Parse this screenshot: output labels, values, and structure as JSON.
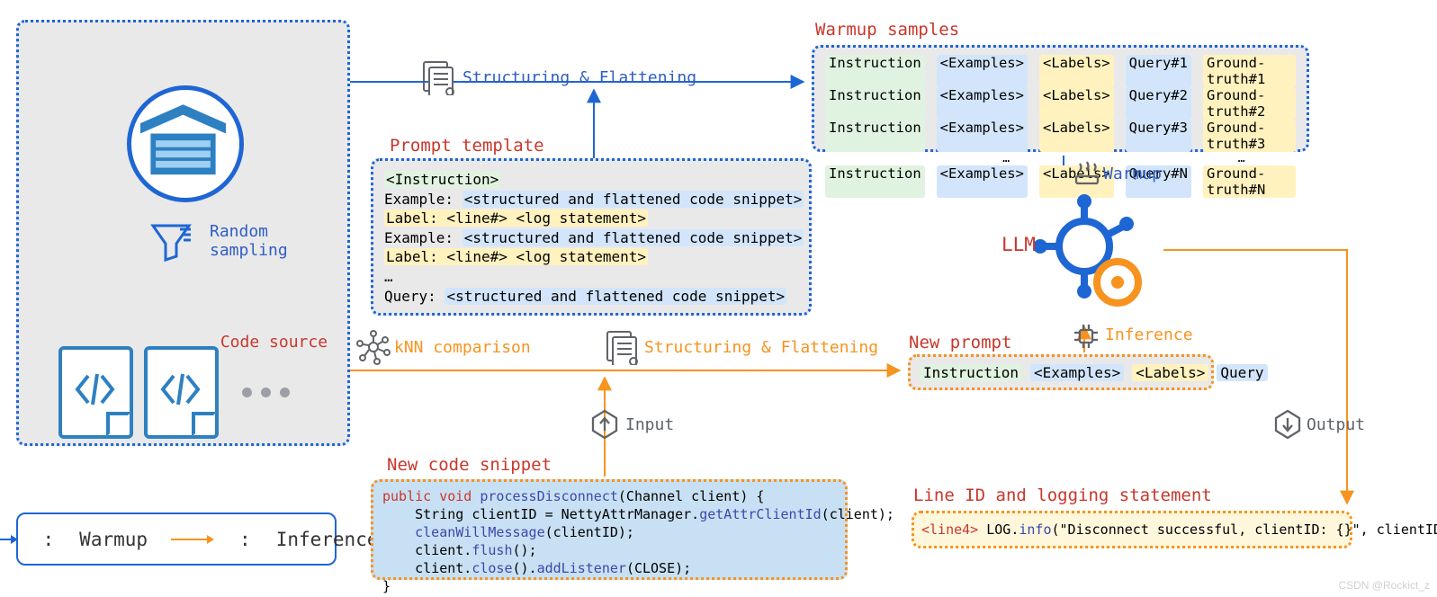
{
  "panels": {
    "code_source_label": "Code source",
    "random_sampling": "Random\nsampling"
  },
  "legend": {
    "warmup": "Warmup",
    "inference": "Inference"
  },
  "arrows": {
    "structuring_flattening": "Structuring & Flattening",
    "knn_comparison": "kNN comparison",
    "input": "Input",
    "warmup": "Warmup",
    "inference": "Inference",
    "output": "Output"
  },
  "prompt_template": {
    "title": "Prompt template",
    "instruction": "<Instruction>",
    "example_prefix": "Example:",
    "example_body": "<structured and flattened code snippet>",
    "label_line": "Label: <line#> <log statement>",
    "ellipsis": "…",
    "query_prefix": "Query:",
    "query_body": "<structured and flattened code snippet>"
  },
  "warmup_samples": {
    "title": "Warmup samples",
    "rows": [
      {
        "instr": "Instruction",
        "ex": "<Examples>",
        "lab": "<Labels>",
        "q": "Query#1",
        "gt": "Ground-truth#1"
      },
      {
        "instr": "Instruction",
        "ex": "<Examples>",
        "lab": "<Labels>",
        "q": "Query#2",
        "gt": "Ground-truth#2"
      },
      {
        "instr": "Instruction",
        "ex": "<Examples>",
        "lab": "<Labels>",
        "q": "Query#3",
        "gt": "Ground-truth#3"
      },
      {
        "instr": "Instruction",
        "ex": "<Examples>",
        "lab": "<Labels>",
        "q": "Query#N",
        "gt": "Ground-truth#N"
      }
    ],
    "ellipsis": "…"
  },
  "new_prompt": {
    "title": "New prompt",
    "instr": "Instruction",
    "ex": "<Examples>",
    "lab": "<Labels>",
    "q": "Query"
  },
  "new_code_snippet": {
    "title": "New code snippet",
    "lines": [
      {
        "raw": "public void processDisconnect(Channel client) {"
      },
      {
        "raw": "    String clientID = NettyAttrManager.getAttrClientId(client);"
      },
      {
        "raw": "    cleanWillMessage(clientID);"
      },
      {
        "raw": "    client.flush();"
      },
      {
        "raw": "    client.close().addListener(CLOSE);"
      },
      {
        "raw": "}"
      }
    ]
  },
  "llm_label": "LLM",
  "output": {
    "title": "Line ID and logging statement",
    "line_tag": "<line4>",
    "text": " LOG.info(\"Disconnect successful, clientID: {}\", clientID);"
  },
  "watermark": "CSDN @Rockict_z"
}
